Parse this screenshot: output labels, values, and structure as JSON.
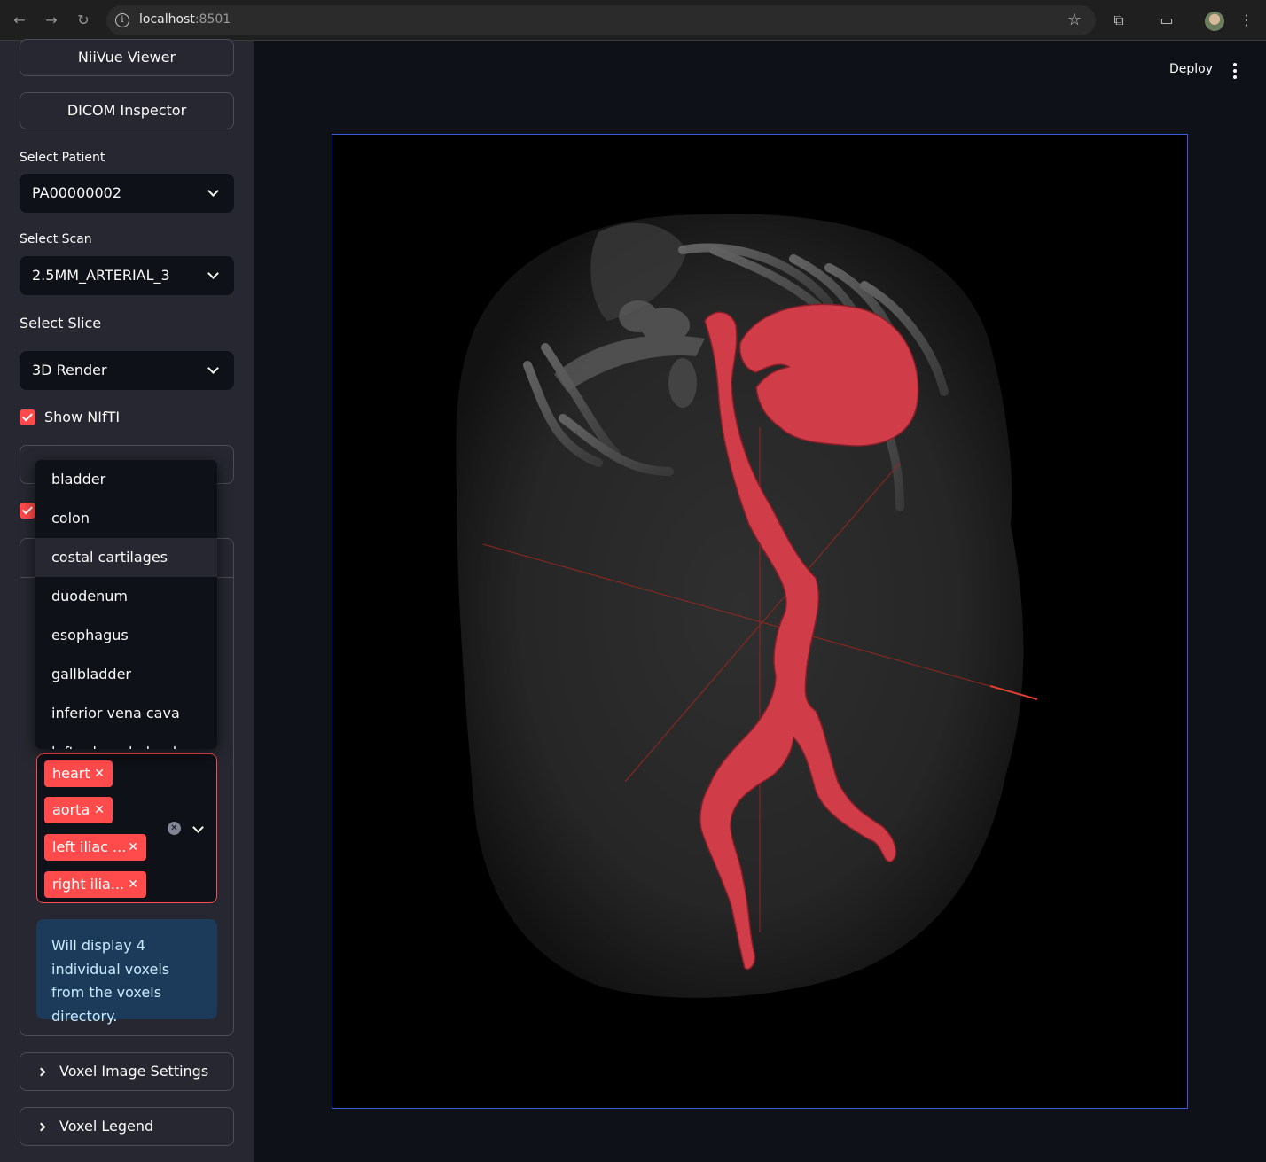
{
  "browser": {
    "url_host": "localhost",
    "url_port": ":8501"
  },
  "sidebar": {
    "buttons": [
      "NiiVue Viewer",
      "DICOM Inspector"
    ],
    "patient": {
      "label": "Select Patient",
      "value": "PA00000002"
    },
    "scan": {
      "label": "Select Scan",
      "value": "2.5MM_ARTERIAL_3"
    },
    "slice": {
      "label": "Select Slice",
      "value": "3D Render"
    },
    "show_nifti": {
      "label": "Show NIfTI",
      "checked": true
    },
    "voxel_select": {
      "options": [
        "bladder",
        "colon",
        "costal cartilages",
        "duodenum",
        "esophagus",
        "gallbladder",
        "inferior vena cava",
        "left adrenal gland"
      ],
      "highlighted": "costal cartilages",
      "selected": [
        "heart",
        "aorta",
        "left iliac ...",
        "right ilia..."
      ]
    },
    "info": "Will display 4 individual voxels from the voxels directory.",
    "expanders": [
      "Voxel Image Settings",
      "Voxel Legend"
    ]
  },
  "header": {
    "deploy_label": "Deploy"
  },
  "colors": {
    "accent": "#ff4b4b",
    "sidebar_bg": "#262730",
    "main_bg": "#0e1117",
    "viewer_border": "#3a5bd9",
    "segmentation": "#d03c48"
  }
}
